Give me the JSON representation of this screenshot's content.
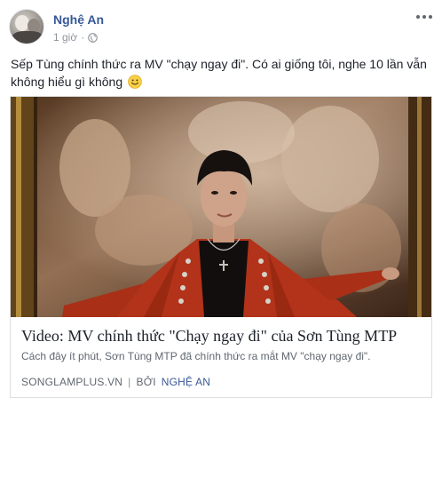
{
  "post": {
    "page_name": "Nghệ An",
    "time": "1 giờ",
    "separator": "·",
    "privacy_icon": "globe-icon",
    "more_icon": "more-options-icon",
    "text": "Sếp Tùng chính thức ra MV \"chạy ngay đi\". Có ai giống tôi, nghe 10 lần vẫn không hiểu gì không",
    "emoji": "smile-icon"
  },
  "link_card": {
    "title": "Video: MV chính thức \"Chạy ngay đi\" của Sơn Tùng MTP",
    "description": "Cách đây ít phút, Sơn Tùng MTP đã chính thức ra mắt MV \"chạy ngay đi\".",
    "source": "SONGLAMPLUS.VN",
    "source_sep": "|",
    "by_label": "BỞI",
    "author": "NGHỆ AN"
  },
  "colors": {
    "link_blue": "#385898",
    "meta_gray": "#90949c",
    "jacket_red": "#c2381c"
  }
}
